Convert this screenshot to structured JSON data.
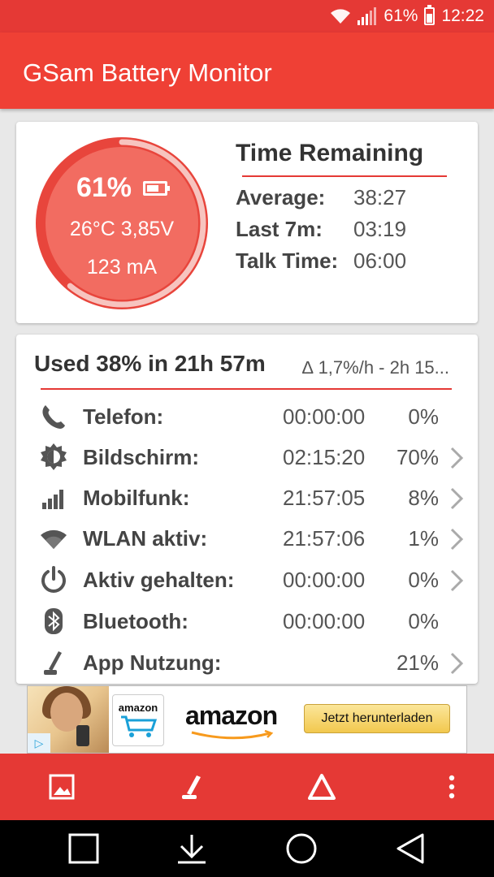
{
  "status_bar": {
    "battery_pct": "61%",
    "time": "12:22",
    "icons": [
      "wifi-icon",
      "cell-signal-icon",
      "battery-icon"
    ]
  },
  "app_bar": {
    "title": "GSam Battery Monitor"
  },
  "battery_card": {
    "percent": "61%",
    "percent_value": 61,
    "temp_voltage": "26°C  3,85V",
    "current": "123 mA",
    "time_remaining_title": "Time Remaining",
    "rows": [
      {
        "label": "Average:",
        "value": "38:27"
      },
      {
        "label": "Last 7m:",
        "value": "03:19"
      },
      {
        "label": "Talk Time:",
        "value": "06:00"
      }
    ],
    "colors": {
      "gauge_outer": "#e8453c",
      "gauge_inner": "#f26c61",
      "accent": "#e53935"
    }
  },
  "usage_card": {
    "title": "Used 38% in 21h 57m",
    "rate": "∆ 1,7%/h - 2h 15...",
    "rows": [
      {
        "icon": "phone-icon",
        "name": "Telefon:",
        "time": "00:00:00",
        "pct": "0%",
        "has_chevron": false
      },
      {
        "icon": "brightness-icon",
        "name": "Bildschirm:",
        "time": "02:15:20",
        "pct": "70%",
        "has_chevron": true
      },
      {
        "icon": "signal-bars-icon",
        "name": "Mobilfunk:",
        "time": "21:57:05",
        "pct": "8%",
        "has_chevron": true
      },
      {
        "icon": "wifi-icon",
        "name": "WLAN aktiv:",
        "time": "21:57:06",
        "pct": "1%",
        "has_chevron": true
      },
      {
        "icon": "power-icon",
        "name": "Aktiv gehalten:",
        "time": "00:00:00",
        "pct": "0%",
        "has_chevron": true
      },
      {
        "icon": "bluetooth-icon",
        "name": "Bluetooth:",
        "time": "00:00:00",
        "pct": "0%",
        "has_chevron": false
      },
      {
        "icon": "app-usage-icon",
        "name": "App Nutzung:",
        "time": "",
        "pct": "21%",
        "has_chevron": true
      }
    ]
  },
  "ad": {
    "app_icon_text": "amazon",
    "brand": "amazon",
    "button": "Jetzt herunterladen"
  },
  "bottom_bar": {
    "buttons": [
      "image-icon",
      "app-usage-icon",
      "delta-icon",
      "more-vert-icon"
    ]
  },
  "nav_bar": {
    "buttons": [
      "recents-icon",
      "download-icon",
      "home-icon",
      "back-icon"
    ]
  }
}
